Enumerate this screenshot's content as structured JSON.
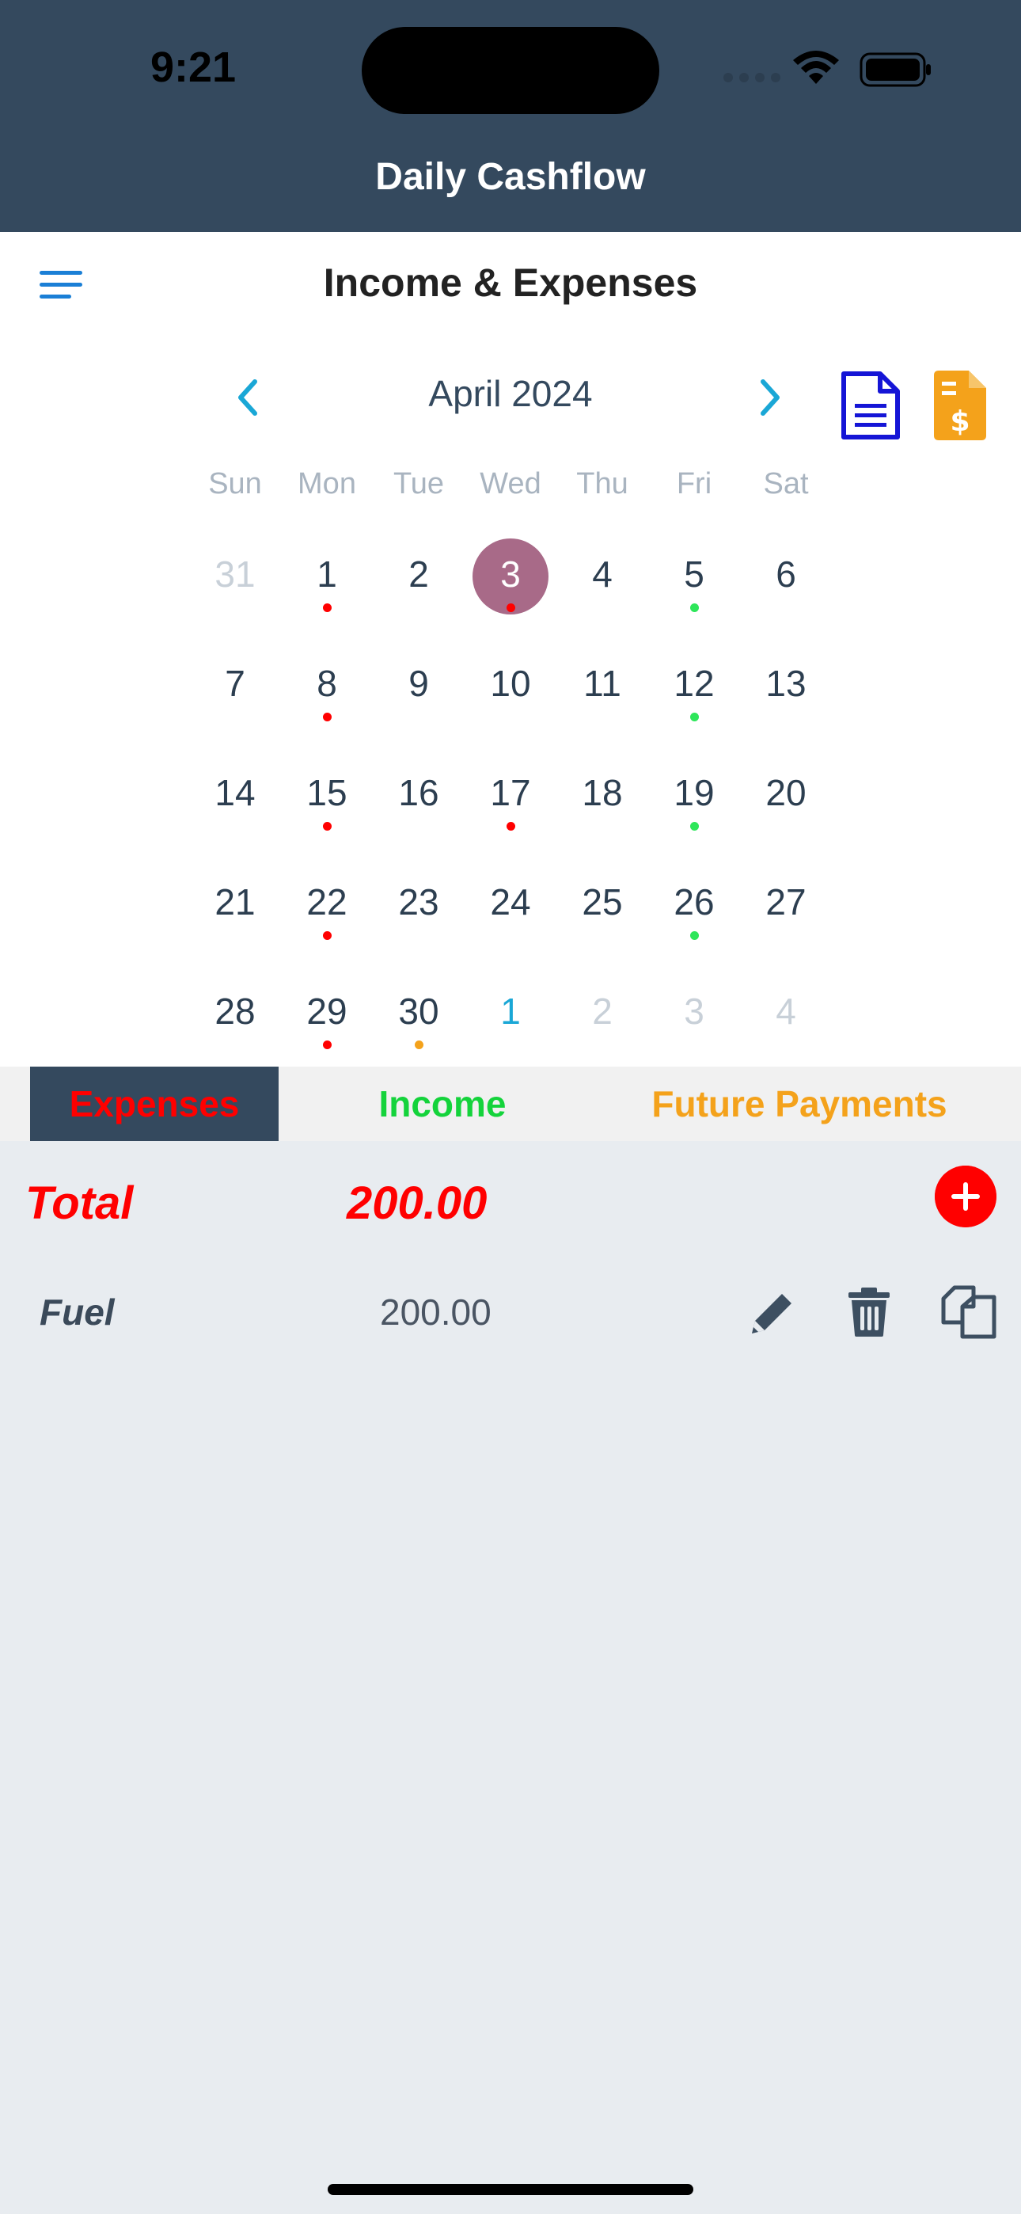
{
  "status_bar": {
    "time": "9:21"
  },
  "app": {
    "title": "Daily Cashflow"
  },
  "page": {
    "title": "Income & Expenses"
  },
  "calendar": {
    "month_label": "April 2024",
    "weekdays": [
      "Sun",
      "Mon",
      "Tue",
      "Wed",
      "Thu",
      "Fri",
      "Sat"
    ],
    "weeks": [
      [
        {
          "day": "31",
          "type": "outside"
        },
        {
          "day": "1",
          "type": "current",
          "dot": "#ff0000"
        },
        {
          "day": "2",
          "type": "current"
        },
        {
          "day": "3",
          "type": "selected",
          "dot": "#ff0000"
        },
        {
          "day": "4",
          "type": "current"
        },
        {
          "day": "5",
          "type": "current",
          "dot": "#2ee65a"
        },
        {
          "day": "6",
          "type": "current"
        }
      ],
      [
        {
          "day": "7",
          "type": "current"
        },
        {
          "day": "8",
          "type": "current",
          "dot": "#ff0000"
        },
        {
          "day": "9",
          "type": "current"
        },
        {
          "day": "10",
          "type": "current"
        },
        {
          "day": "11",
          "type": "current"
        },
        {
          "day": "12",
          "type": "current",
          "dot": "#2ee65a"
        },
        {
          "day": "13",
          "type": "current"
        }
      ],
      [
        {
          "day": "14",
          "type": "current"
        },
        {
          "day": "15",
          "type": "current",
          "dot": "#ff0000"
        },
        {
          "day": "16",
          "type": "current"
        },
        {
          "day": "17",
          "type": "current",
          "dot": "#ff0000"
        },
        {
          "day": "18",
          "type": "current"
        },
        {
          "day": "19",
          "type": "current",
          "dot": "#2ee65a"
        },
        {
          "day": "20",
          "type": "current"
        }
      ],
      [
        {
          "day": "21",
          "type": "current"
        },
        {
          "day": "22",
          "type": "current",
          "dot": "#ff0000"
        },
        {
          "day": "23",
          "type": "current"
        },
        {
          "day": "24",
          "type": "current"
        },
        {
          "day": "25",
          "type": "current"
        },
        {
          "day": "26",
          "type": "current",
          "dot": "#2ee65a"
        },
        {
          "day": "27",
          "type": "current"
        }
      ],
      [
        {
          "day": "28",
          "type": "current"
        },
        {
          "day": "29",
          "type": "current",
          "dot": "#ff0000"
        },
        {
          "day": "30",
          "type": "current",
          "dot": "#f4a21b"
        },
        {
          "day": "1",
          "type": "next-month"
        },
        {
          "day": "2",
          "type": "outside"
        },
        {
          "day": "3",
          "type": "outside"
        },
        {
          "day": "4",
          "type": "outside"
        }
      ]
    ]
  },
  "tabs": {
    "expenses": "Expenses",
    "income": "Income",
    "future": "Future Payments"
  },
  "summary": {
    "total_label": "Total",
    "total_value": "200.00"
  },
  "entries": [
    {
      "label": "Fuel",
      "amount": "200.00"
    }
  ],
  "colors": {
    "header_bg": "#34495e",
    "expense_red": "#ff0000",
    "income_green": "#14d33b",
    "future_orange": "#f4a21b",
    "accent_blue": "#1aa7d6",
    "selected_day": "#a86a88"
  },
  "icons": {
    "menu": "menu-icon",
    "prev": "chevron-left-icon",
    "next": "chevron-right-icon",
    "document": "document-icon",
    "invoice": "invoice-icon",
    "add": "plus-icon",
    "edit": "pencil-icon",
    "delete": "trash-icon",
    "copy": "copy-icon"
  }
}
